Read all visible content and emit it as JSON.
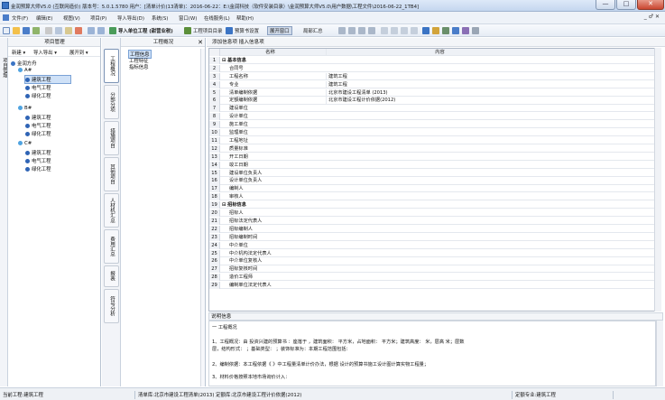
{
  "window": {
    "title": "金润预算大师V5.0 (互联网造价) 版本号：5.0.1.5780  用户：[清单计价(13清单)：2016-06-22：E:\\金润科技（软件安装目录）\\金润预算大师V5.0\\用户数据\\工程文件\\2016-06-22_1TB4]",
    "controls": [
      "—",
      "□",
      "✕"
    ]
  },
  "menu": {
    "items": [
      "文件(F)",
      "编辑(E)",
      "视图(V)",
      "项目(P)",
      "导入导出(D)",
      "系统(S)",
      "窗口(W)",
      "在线服务(L)",
      "帮助(H)"
    ],
    "mdi": "_ ♂ ✕"
  },
  "toolbar": {
    "import_label": "导入单位工程 (甜营业税)",
    "proj_dir": "工程项目目录",
    "preview": "预算书设置",
    "page_window": "展开窗口",
    "summary": "局部汇总"
  },
  "left_panel": {
    "vtab": "项目管理",
    "header": "项目管理",
    "tools": [
      "新建 ▾",
      "导入导出 ▾",
      "展开到 ▾"
    ],
    "root": "金润方舟",
    "groups": [
      {
        "name": "A#",
        "children": [
          "建筑工程",
          "电气工程",
          "绿化工程"
        ]
      },
      {
        "name": "B#",
        "children": [
          "建筑工程",
          "电气工程",
          "绿化工程"
        ]
      },
      {
        "name": "C#",
        "children": [
          "建筑工程",
          "电气工程",
          "绿化工程"
        ]
      }
    ]
  },
  "mid_tabs": [
    "工程概况",
    "分部分项",
    "措施项目",
    "其他项目",
    "人材机汇总",
    "费用汇总",
    "报表",
    "符号分析"
  ],
  "overview": {
    "header": "工程概况",
    "close": "✕",
    "items": [
      "工程信息",
      "工程特征",
      "指标信息"
    ]
  },
  "right_panel": {
    "tabs": "添加信息项  插入信息项",
    "col_name": "名称",
    "col_content": "内容",
    "rows": [
      {
        "n": "1",
        "name": "⊟ 基本信息",
        "val": ""
      },
      {
        "n": "2",
        "name": "合同号",
        "val": ""
      },
      {
        "n": "3",
        "name": "工程名称",
        "val": "建筑工程"
      },
      {
        "n": "4",
        "name": "专业",
        "val": "建筑工程"
      },
      {
        "n": "5",
        "name": "清单编制依据",
        "val": "北京市建设工程清单 (2013)"
      },
      {
        "n": "6",
        "name": "定额编制依据",
        "val": "北京市建设工程计价依据(2012)"
      },
      {
        "n": "7",
        "name": "建设单位",
        "val": ""
      },
      {
        "n": "8",
        "name": "设计单位",
        "val": ""
      },
      {
        "n": "9",
        "name": "施工单位",
        "val": ""
      },
      {
        "n": "10",
        "name": "监理单位",
        "val": ""
      },
      {
        "n": "11",
        "name": "工程地址",
        "val": ""
      },
      {
        "n": "12",
        "name": "质量标准",
        "val": ""
      },
      {
        "n": "13",
        "name": "开工日期",
        "val": ""
      },
      {
        "n": "14",
        "name": "竣工日期",
        "val": ""
      },
      {
        "n": "15",
        "name": "建设单位负责人",
        "val": ""
      },
      {
        "n": "16",
        "name": "设计单位负责人",
        "val": ""
      },
      {
        "n": "17",
        "name": "编制人",
        "val": ""
      },
      {
        "n": "18",
        "name": "审核人",
        "val": ""
      },
      {
        "n": "19",
        "name": "⊟ 招标信息",
        "val": ""
      },
      {
        "n": "20",
        "name": "招标人",
        "val": ""
      },
      {
        "n": "21",
        "name": "招标法定代表人",
        "val": ""
      },
      {
        "n": "22",
        "name": "招标编制人",
        "val": ""
      },
      {
        "n": "23",
        "name": "招标编制时间",
        "val": ""
      },
      {
        "n": "24",
        "name": "中介单位",
        "val": ""
      },
      {
        "n": "25",
        "name": "中介机构法定代表人",
        "val": ""
      },
      {
        "n": "26",
        "name": "中介单位复核人",
        "val": ""
      },
      {
        "n": "27",
        "name": "招标复核时间",
        "val": ""
      },
      {
        "n": "28",
        "name": "造价工程师",
        "val": ""
      },
      {
        "n": "29",
        "name": "编制单位法定代表人",
        "val": ""
      }
    ],
    "desc_title": "说明信息",
    "desc_lines": [
      "一 工程概况",
      "1、工程概况：由         投资兴建的预算书 ：座落于           ，建筑面积：          平方米，占地面积：          平方米；建筑高度：           米，层高         米；层数",
      "层，结构形式：          ；基础类型：           ；装饰标准为：本期工程范围包括：",
      "2、编制依据：本工程依据《          》中工程量清单计价办法，根据         设计的预算书施工设计图计算实物工程量；",
      "3、材料价格按照本地市场询价计入："
    ]
  },
  "status": {
    "seg1": "当前工程:建筑工程",
    "seg2": "清单库:北京市建设工程清单(2013)    定额库:北京市建设工程计价依据(2012)",
    "seg3": "定额专业:建筑工程"
  },
  "colors": {
    "accent": "#3b74c4",
    "select": "#cfe1f7"
  }
}
